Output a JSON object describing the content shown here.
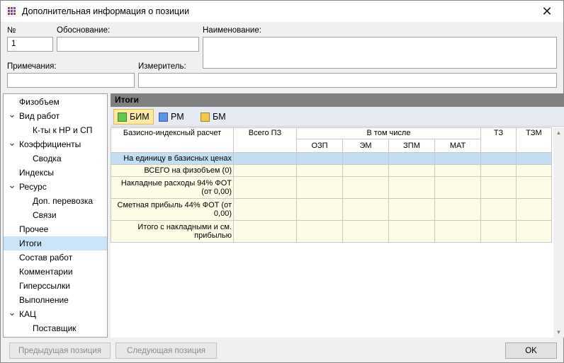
{
  "window": {
    "title": "Дополнительная информация о позиции"
  },
  "form": {
    "number_label": "№",
    "number_value": "1",
    "basis_label": "Обоснование:",
    "basis_value": "",
    "name_label": "Наименование:",
    "name_value": "",
    "notes_label": "Примечания:",
    "notes_value": "",
    "unit_label": "Измеритель:",
    "unit_value": ""
  },
  "tree": {
    "items": [
      {
        "label": "Физобъем",
        "expandable": false
      },
      {
        "label": "Вид работ",
        "expandable": true
      },
      {
        "label": "К-ты к НР и СП",
        "expandable": false
      },
      {
        "label": "Коэффициенты",
        "expandable": true
      },
      {
        "label": "Сводка",
        "expandable": false
      },
      {
        "label": "Индексы",
        "expandable": false
      },
      {
        "label": "Ресурс",
        "expandable": true
      },
      {
        "label": "Доп. перевозка",
        "expandable": false
      },
      {
        "label": "Связи",
        "expandable": false
      },
      {
        "label": "Прочее",
        "expandable": false
      },
      {
        "label": "Итоги",
        "expandable": false,
        "selected": true
      },
      {
        "label": "Состав работ",
        "expandable": false
      },
      {
        "label": "Комментарии",
        "expandable": false
      },
      {
        "label": "Гиперссылки",
        "expandable": false
      },
      {
        "label": "Выполнение",
        "expandable": false
      },
      {
        "label": "КАЦ",
        "expandable": true
      },
      {
        "label": "Поставщик",
        "expandable": false
      }
    ]
  },
  "panel": {
    "title": "Итоги",
    "tabs": [
      {
        "label": "БИМ",
        "color": "#5ecb4e",
        "active": true
      },
      {
        "label": "РМ",
        "color": "#5a93e8",
        "active": false
      },
      {
        "label": "БМ",
        "color": "#f2c94c",
        "active": false
      }
    ]
  },
  "grid": {
    "headers": {
      "calc": "Базисно-индексный расчет",
      "total": "Всего ПЗ",
      "including": "В том числе",
      "tz": "ТЗ",
      "tzm": "ТЗМ",
      "sub": [
        "ОЗП",
        "ЭМ",
        "ЗПМ",
        "МАТ"
      ]
    },
    "band_row": "На единицу в базисных ценах",
    "rows": [
      "ВСЕГО на физобъем (0)",
      "Накладные расходы 94% ФОТ (от 0,00)",
      "Сметная прибыль 44% ФОТ (от 0,00)",
      "Итого с накладными и см. прибылью"
    ]
  },
  "buttons": {
    "prev": "Предыдущая позиция",
    "next": "Следующая позиция",
    "ok": "OK"
  }
}
